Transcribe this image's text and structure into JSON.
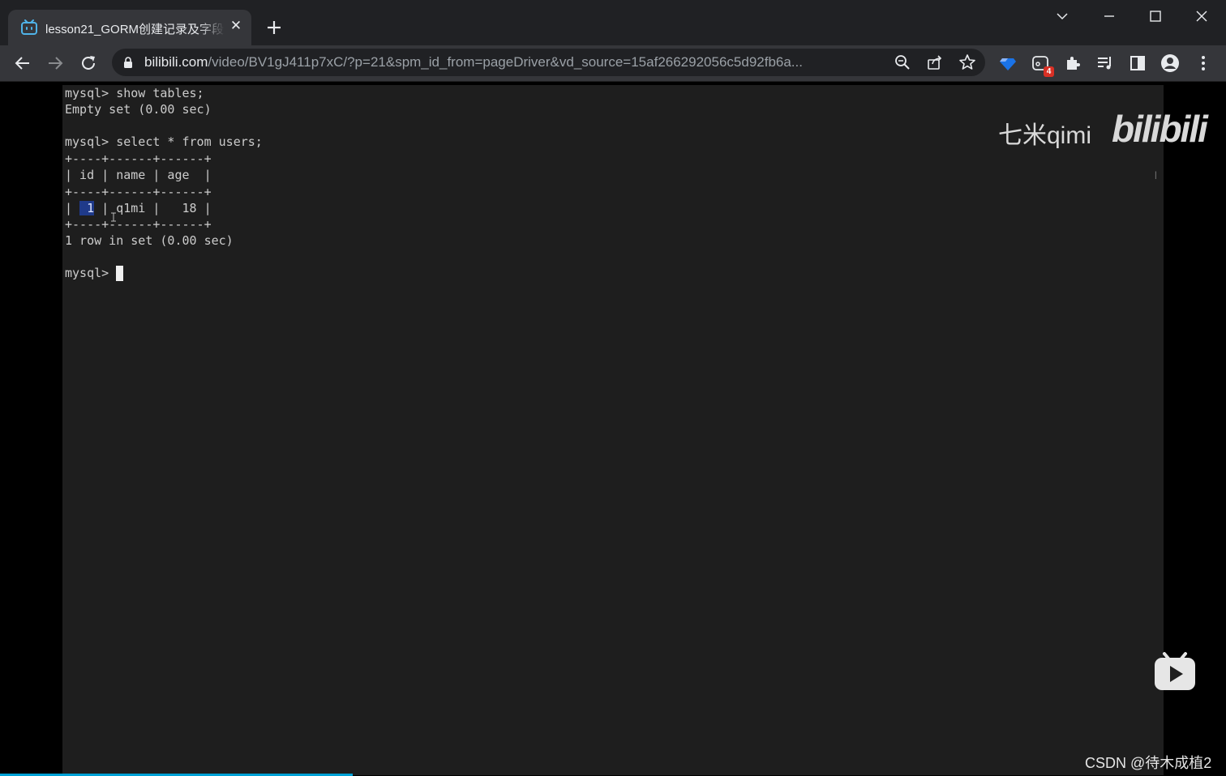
{
  "tab": {
    "title": "lesson21_GORM创建记录及字段",
    "close_label": "✕"
  },
  "omnibox": {
    "host": "bilibili.com",
    "path": "/video/BV1gJ411p7xC/?p=21&spm_id_from=pageDriver&vd_source=15af266292056c5d92fb6a..."
  },
  "extensions": {
    "badge_count": "4"
  },
  "terminal": {
    "lines": [
      "mysql> show tables;",
      "Empty set (0.00 sec)",
      "",
      "mysql> select * from users;",
      "+----+------+------+",
      "| id | name | age  |",
      "+----+------+------+",
      "",
      "+----+------+------+",
      "1 row in set (0.00 sec)",
      "",
      "mysql> "
    ],
    "row_prefix": "| ",
    "row_id": " 1",
    "row_rest": " | q1mi |   18 |"
  },
  "watermark": {
    "text": "七米qimi",
    "logo": "bilibili"
  },
  "csdn_watermark": "CSDN @待木成植2",
  "colors": {
    "accent": "#00a1d6",
    "terminal_bg": "#1e1e1e",
    "chrome_bg": "#35363a"
  }
}
